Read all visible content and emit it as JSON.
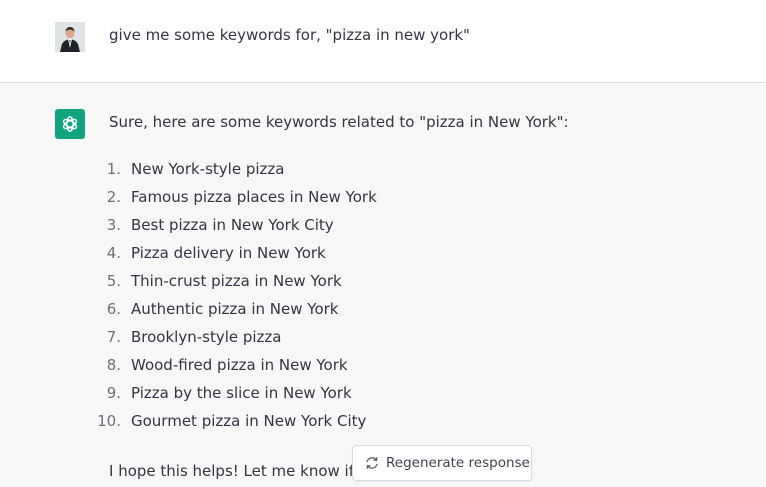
{
  "user_message": {
    "text": "give me some keywords for, \"pizza in new york\""
  },
  "assistant_message": {
    "intro": "Sure, here are some keywords related to \"pizza in New York\":",
    "items": [
      {
        "num": "1.",
        "text": "New York-style pizza"
      },
      {
        "num": "2.",
        "text": "Famous pizza places in New York"
      },
      {
        "num": "3.",
        "text": "Best pizza in New York City"
      },
      {
        "num": "4.",
        "text": "Pizza delivery in New York"
      },
      {
        "num": "5.",
        "text": "Thin-crust pizza in New York"
      },
      {
        "num": "6.",
        "text": "Authentic pizza in New York"
      },
      {
        "num": "7.",
        "text": "Brooklyn-style pizza"
      },
      {
        "num": "8.",
        "text": "Wood-fired pizza in New York"
      },
      {
        "num": "9.",
        "text": "Pizza by the slice in New York"
      },
      {
        "num": "10.",
        "text": "Gourmet pizza in New York City"
      }
    ],
    "outro": "I hope this helps! Let me know if y"
  },
  "regenerate": {
    "label": "Regenerate response",
    "icon": "refresh-icon"
  },
  "colors": {
    "accent": "#10a37f",
    "text": "#343541",
    "assistant_bg": "#f7f7f8",
    "user_bg": "#ffffff"
  }
}
